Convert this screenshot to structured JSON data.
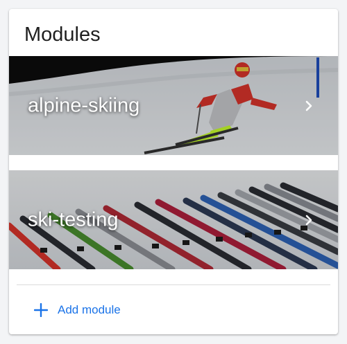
{
  "card": {
    "title": "Modules"
  },
  "modules": [
    {
      "label": "alpine-skiing",
      "image": "alpine-skier-photo",
      "icon": "chevron-right-icon"
    },
    {
      "label": "ski-testing",
      "image": "skis-row-photo",
      "icon": "chevron-right-icon"
    }
  ],
  "actions": {
    "add_module_label": "Add module",
    "add_icon": "plus-icon"
  },
  "colors": {
    "accent": "#1a73e8",
    "card_background": "#ffffff",
    "page_background": "#f3f4f6"
  }
}
